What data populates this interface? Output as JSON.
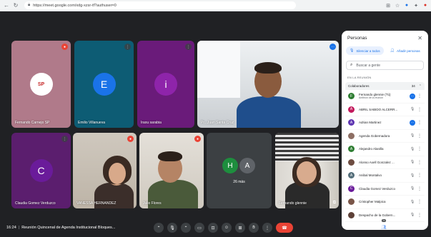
{
  "browser": {
    "url": "https://meet.google.com/xdg-xzsr-tf?authuser=0",
    "icons": {
      "back": "arrow-left-icon",
      "reload": "reload-icon",
      "lock": "lock-icon"
    }
  },
  "tiles": [
    {
      "name": "Fernando Carnejo SP",
      "avatar_text": "SP",
      "bg": "#b07a8a",
      "avatar_bg": "#ffffff",
      "avatar_fg": "#c62828",
      "muted": true
    },
    {
      "name": "Emilio Villanueva",
      "avatar_text": "E",
      "bg": "#0d5c74",
      "avatar_bg": "#1a73e8",
      "muted": false
    },
    {
      "name": "Iraxu sarabia",
      "avatar_text": "i",
      "bg": "#6a1b7a",
      "avatar_bg": "#8e24aa",
      "muted": false
    },
    {
      "name": "Pr...Juan Santa Cruz",
      "muted": false
    },
    {
      "name": "Claudia Gomez Verduzco",
      "avatar_text": "C",
      "bg": "#5b1e6e",
      "avatar_bg": "#6a1b9a",
      "muted": false
    },
    {
      "name": "VANESSA HERNANDEZ",
      "muted": true
    },
    {
      "name": "Julio Flores",
      "muted": true
    },
    {
      "more_count": "26 más",
      "initials": [
        "H",
        "A"
      ]
    },
    {
      "name": "Fernando glennie",
      "muted": false
    }
  ],
  "panel": {
    "title": "Personas",
    "silence_all": "Silenciar a todos",
    "add_people": "Añadir personas",
    "search_placeholder": "Buscar a gente",
    "section_label": "EN LA REUNIÓN",
    "group_label": "Colaboradores",
    "group_count": "34",
    "participants": [
      {
        "name": "Fernando glennie (Tú)",
        "sub": "Anfitrión de la reunión",
        "avatar_bg": "#2e7d32",
        "initial": "F",
        "state": "speaking"
      },
      {
        "name": "ABRIL SABIDO ALCERR...",
        "avatar_bg": "#c2185b",
        "initial": "A",
        "state": "muted"
      },
      {
        "name": "Adrian Martinez",
        "avatar_bg": "#5e35b1",
        "initial": "A",
        "state": "speaking"
      },
      {
        "name": "Agenda Gobernadora",
        "avatar_bg": "#8d6e63",
        "initial": "",
        "state": "muted"
      },
      {
        "name": "Alejandro Alanilla",
        "avatar_bg": "#2e7d32",
        "initial": "A",
        "state": "muted"
      },
      {
        "name": "Alonso Axell Gonzalez ...",
        "avatar_bg": "#6d4c41",
        "initial": "",
        "state": "muted"
      },
      {
        "name": "Anibal Montalvo",
        "avatar_bg": "#546e7a",
        "initial": "A",
        "state": "muted"
      },
      {
        "name": "Claudia Gomez Verduzco",
        "avatar_bg": "#6a1b9a",
        "initial": "C",
        "state": "muted"
      },
      {
        "name": "Cristopher Malpica",
        "avatar_bg": "#795548",
        "initial": "",
        "state": "muted"
      },
      {
        "name": "Despacho de la Gobern...",
        "avatar_bg": "#5d4037",
        "initial": "",
        "state": "muted"
      }
    ]
  },
  "bottom": {
    "time": "16:24",
    "meeting_title": "Reunión Quincenal de Agenda Institucional Bloques...",
    "people_badge": "34"
  }
}
